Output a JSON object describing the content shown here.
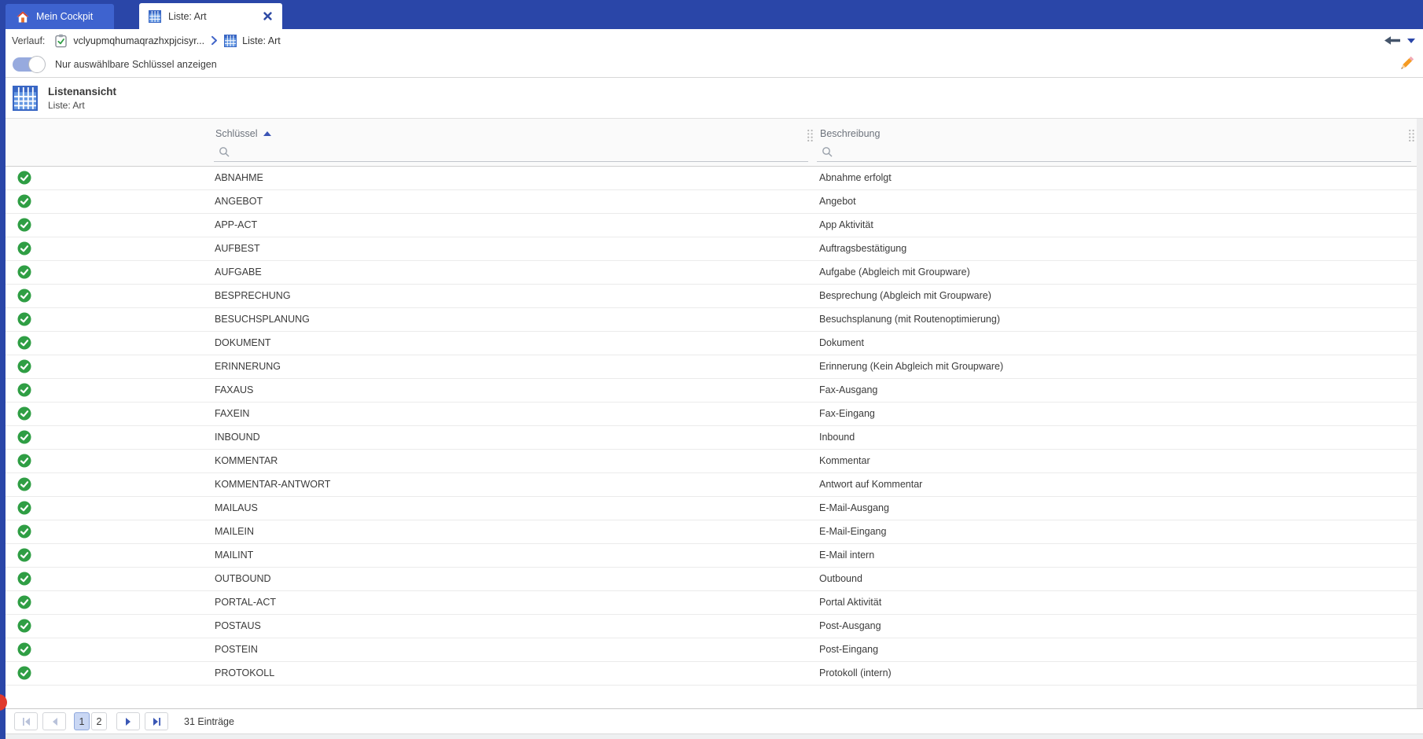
{
  "colors": {
    "topbar": "#2a46a8",
    "tabhl": "#3e63cf",
    "accent": "#3a57b5",
    "linkblue": "#3f63c8",
    "green": "#2f9e44",
    "orange": "#f59b22",
    "red": "#e0392c",
    "pageact": "#c9d7f4",
    "headtext": "#6d737c",
    "rowtext": "#3b3b3b",
    "band": "#fafafa",
    "sep": "#ebebeb"
  },
  "tabs": [
    {
      "label": "Mein Cockpit",
      "icon": "home-icon",
      "active": false
    },
    {
      "label": "Liste: Art",
      "icon": "table-icon",
      "active": true,
      "closable": true
    }
  ],
  "history_bar": {
    "label": "Verlauf:",
    "items": [
      {
        "icon": "clipboard-check-icon",
        "label": "vclyupmqhumaqrazhxpjcisyr..."
      },
      {
        "icon": "table-icon",
        "label": "Liste: Art"
      }
    ]
  },
  "toolbar": {
    "toggle_label": "Nur auswählbare Schlüssel anzeigen",
    "toggle_state": "on"
  },
  "view_header": {
    "title": "Listenansicht",
    "subtitle": "Liste: Art"
  },
  "table": {
    "columns": [
      {
        "label": "Schlüssel",
        "sort": "asc",
        "filter_value": ""
      },
      {
        "label": "Beschreibung",
        "filter_value": ""
      }
    ],
    "rows": [
      {
        "key": "ABNAHME",
        "description": "Abnahme erfolgt"
      },
      {
        "key": "ANGEBOT",
        "description": "Angebot"
      },
      {
        "key": "APP-ACT",
        "description": "App Aktivität"
      },
      {
        "key": "AUFBEST",
        "description": "Auftragsbestätigung"
      },
      {
        "key": "AUFGABE",
        "description": "Aufgabe (Abgleich mit Groupware)"
      },
      {
        "key": "BESPRECHUNG",
        "description": "Besprechung (Abgleich mit Groupware)"
      },
      {
        "key": "BESUCHSPLANUNG",
        "description": "Besuchsplanung (mit Routenoptimierung)"
      },
      {
        "key": "DOKUMENT",
        "description": "Dokument"
      },
      {
        "key": "ERINNERUNG",
        "description": "Erinnerung (Kein Abgleich mit Groupware)"
      },
      {
        "key": "FAXAUS",
        "description": "Fax-Ausgang"
      },
      {
        "key": "FAXEIN",
        "description": "Fax-Eingang"
      },
      {
        "key": "INBOUND",
        "description": "Inbound"
      },
      {
        "key": "KOMMENTAR",
        "description": "Kommentar"
      },
      {
        "key": "KOMMENTAR-ANTWORT",
        "description": "Antwort auf Kommentar"
      },
      {
        "key": "MAILAUS",
        "description": "E-Mail-Ausgang"
      },
      {
        "key": "MAILEIN",
        "description": "E-Mail-Eingang"
      },
      {
        "key": "MAILINT",
        "description": "E-Mail intern"
      },
      {
        "key": "OUTBOUND",
        "description": "Outbound"
      },
      {
        "key": "PORTAL-ACT",
        "description": "Portal Aktivität"
      },
      {
        "key": "POSTAUS",
        "description": "Post-Ausgang"
      },
      {
        "key": "POSTEIN",
        "description": "Post-Eingang"
      },
      {
        "key": "PROTOKOLL",
        "description": "Protokoll (intern)"
      }
    ]
  },
  "pagination": {
    "pages": [
      "1",
      "2"
    ],
    "current_page": "1",
    "count_label": "31 Einträge"
  }
}
